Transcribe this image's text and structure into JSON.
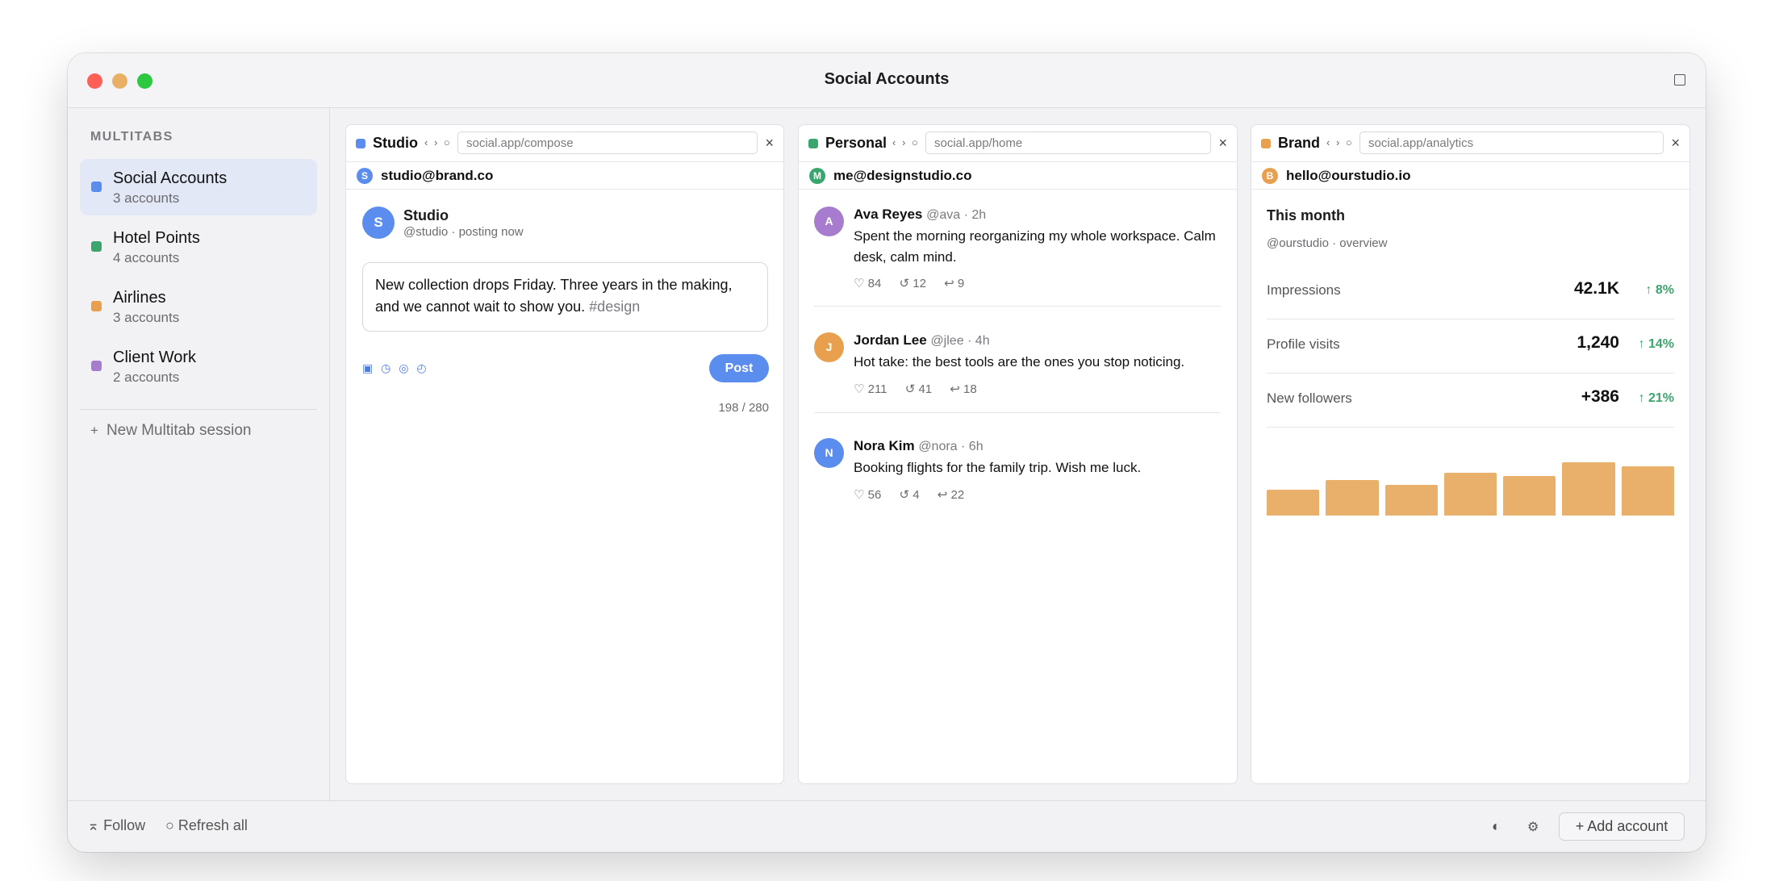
{
  "window": {
    "title": "Social Accounts"
  },
  "sidebar": {
    "heading": "MULTITABS",
    "items": [
      {
        "name": "Social Accounts",
        "count": "3 accounts",
        "color": "#5b8def",
        "active": true
      },
      {
        "name": "Hotel Points",
        "count": "4 accounts",
        "color": "#3aa66d",
        "active": false
      },
      {
        "name": "Airlines",
        "count": "3 accounts",
        "color": "#e8a04f",
        "active": false
      },
      {
        "name": "Client Work",
        "count": "2 accounts",
        "color": "#a77ccf",
        "active": false
      }
    ],
    "new_session": "New Multitab session"
  },
  "panes": {
    "studio": {
      "name": "Studio",
      "color": "#5b8def",
      "nav": "‹ › ○",
      "url": "social.app/compose",
      "close": "×",
      "account_initial": "S",
      "account_email": "studio@brand.co",
      "compose": {
        "avatar": "S",
        "name": "Studio",
        "handle": "@studio · posting now",
        "text": "New collection drops Friday. Three years in the making, and we cannot wait to show you.",
        "hashtag": "#design",
        "tools": "▣ ◷ ◎ ◴",
        "post_label": "Post",
        "counter": "198 / 280"
      }
    },
    "personal": {
      "name": "Personal",
      "color": "#3aa66d",
      "nav": "‹ › ○",
      "url": "social.app/home",
      "close": "×",
      "account_initial": "M",
      "account_email": "me@designstudio.co",
      "posts": [
        {
          "initial": "A",
          "avatar_color": "#a77ccf",
          "author": "Ava Reyes",
          "meta": "@ava · 2h",
          "text": "Spent the morning reorganizing my whole workspace. Calm desk, calm mind.",
          "likes": "♡ 84",
          "reposts": "↺ 12",
          "replies": "↩ 9"
        },
        {
          "initial": "J",
          "avatar_color": "#e8a04f",
          "author": "Jordan Lee",
          "meta": "@jlee · 4h",
          "text": "Hot take: the best tools are the ones you stop noticing.",
          "likes": "♡ 211",
          "reposts": "↺ 41",
          "replies": "↩ 18"
        },
        {
          "initial": "N",
          "avatar_color": "#5b8def",
          "author": "Nora Kim",
          "meta": "@nora · 6h",
          "text": "Booking flights for the family trip. Wish me luck.",
          "likes": "♡ 56",
          "reposts": "↺ 4",
          "replies": "↩ 22"
        }
      ]
    },
    "brand": {
      "name": "Brand",
      "color": "#e8a04f",
      "nav": "‹ › ○",
      "url": "social.app/analytics",
      "close": "×",
      "account_initial": "B",
      "account_email": "hello@ourstudio.io",
      "analytics": {
        "title": "This month",
        "subtitle": "@ourstudio · overview",
        "metrics": [
          {
            "label": "Impressions",
            "value": "42.1K",
            "delta": "↑ 8%"
          },
          {
            "label": "Profile visits",
            "value": "1,240",
            "delta": "↑ 14%"
          },
          {
            "label": "New followers",
            "value": "+386",
            "delta": "↑ 21%"
          }
        ],
        "bar_levels": [
          0.46,
          0.63,
          0.54,
          0.76,
          0.7,
          0.94,
          0.87
        ],
        "bar_color": "#e8b06b"
      }
    }
  },
  "footer": {
    "follow": "⌅ Follow",
    "refresh": "○ Refresh all",
    "contrast_icon": "◐",
    "settings_icon": "⚙",
    "add_account": "+ Add account"
  }
}
